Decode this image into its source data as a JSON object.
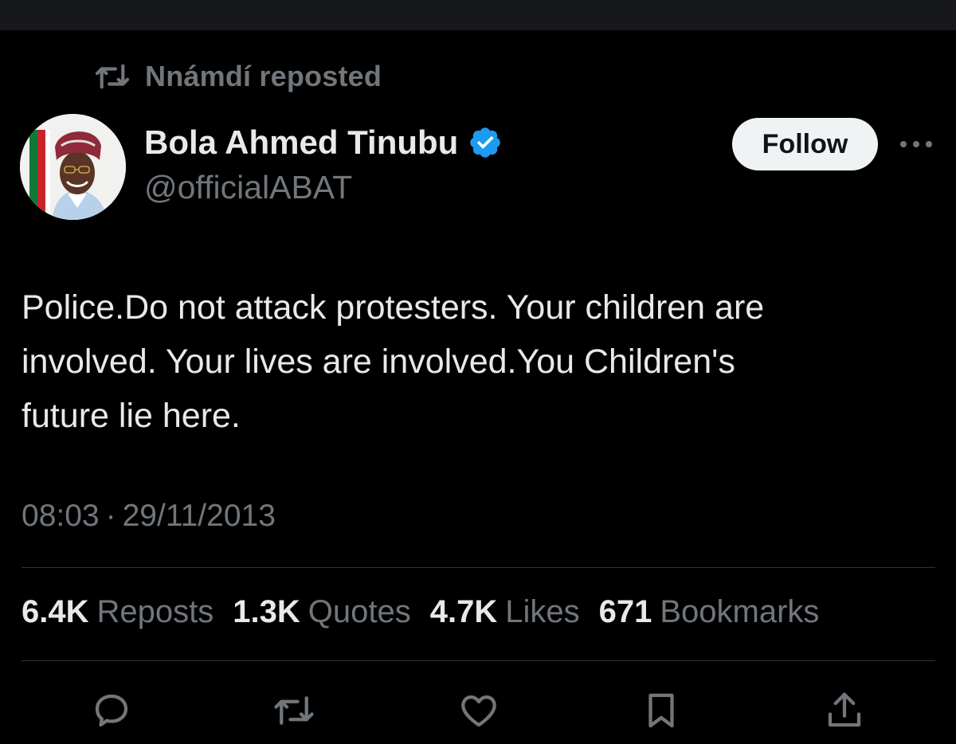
{
  "repost_context": {
    "text": "Nnámdí reposted",
    "icon": "repost-icon"
  },
  "author": {
    "display_name": "Bola Ahmed Tinubu",
    "handle": "@officialABAT",
    "verified": true,
    "verified_color": "#1d9bf0",
    "avatar": "profile-photo"
  },
  "follow_label": "Follow",
  "more_icon": "more-icon",
  "tweet": {
    "lines": [
      "Police.Do not attack protesters. Your children are",
      "involved. Your lives are involved.You Children's",
      "future lie here."
    ]
  },
  "meta": {
    "time": "08:03",
    "separator": "·",
    "date": "29/11/2013"
  },
  "stats": [
    {
      "value": "6.4K",
      "label": "Reposts"
    },
    {
      "value": "1.3K",
      "label": "Quotes"
    },
    {
      "value": "4.7K",
      "label": "Likes"
    },
    {
      "value": "671",
      "label": "Bookmarks"
    }
  ],
  "actions": [
    "reply-icon",
    "repost-icon",
    "like-icon",
    "bookmark-icon",
    "share-icon"
  ],
  "colors": {
    "background": "#000000",
    "text": "#e7e9ea",
    "muted": "#71767b",
    "divider": "#2f3336",
    "follow_bg": "#eff3f4"
  }
}
